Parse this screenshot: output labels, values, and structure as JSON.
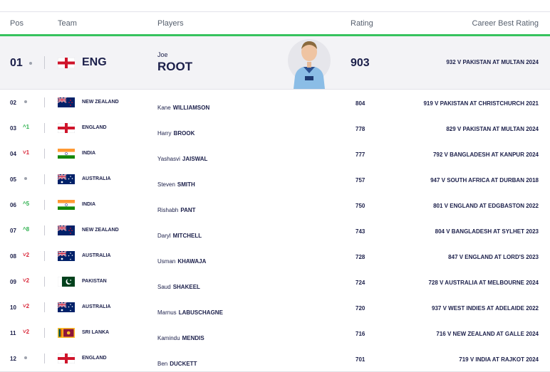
{
  "headers": {
    "pos": "Pos",
    "team": "Team",
    "players": "Players",
    "rating": "Rating",
    "best": "Career Best Rating"
  },
  "featured": {
    "pos": "01",
    "team": "ENG",
    "flag": "eng",
    "first": "Joe",
    "last": "ROOT",
    "rating": "903",
    "best": "932 V PAKISTAN AT MULTAN 2024"
  },
  "rows": [
    {
      "pos": "02",
      "move": "",
      "dir": "same",
      "team": "NEW ZEALAND",
      "flag": "nz",
      "first": "Kane",
      "last": "WILLIAMSON",
      "rating": "804",
      "best": "919 V PAKISTAN AT CHRISTCHURCH 2021"
    },
    {
      "pos": "03",
      "move": "1",
      "dir": "up",
      "team": "ENGLAND",
      "flag": "eng",
      "first": "Harry",
      "last": "BROOK",
      "rating": "778",
      "best": "829 V PAKISTAN AT MULTAN 2024"
    },
    {
      "pos": "04",
      "move": "1",
      "dir": "down",
      "team": "INDIA",
      "flag": "ind",
      "first": "Yashasvi",
      "last": "JAISWAL",
      "rating": "777",
      "best": "792 V BANGLADESH AT KANPUR 2024"
    },
    {
      "pos": "05",
      "move": "",
      "dir": "same",
      "team": "AUSTRALIA",
      "flag": "aus",
      "first": "Steven",
      "last": "SMITH",
      "rating": "757",
      "best": "947 V SOUTH AFRICA AT DURBAN 2018"
    },
    {
      "pos": "06",
      "move": "5",
      "dir": "up",
      "team": "INDIA",
      "flag": "ind",
      "first": "Rishabh",
      "last": "PANT",
      "rating": "750",
      "best": "801 V ENGLAND AT EDGBASTON 2022"
    },
    {
      "pos": "07",
      "move": "8",
      "dir": "up",
      "team": "NEW ZEALAND",
      "flag": "nz",
      "first": "Daryl",
      "last": "MITCHELL",
      "rating": "743",
      "best": "804 V BANGLADESH AT SYLHET 2023"
    },
    {
      "pos": "08",
      "move": "2",
      "dir": "down",
      "team": "AUSTRALIA",
      "flag": "aus",
      "first": "Usman",
      "last": "KHAWAJA",
      "rating": "728",
      "best": "847 V ENGLAND AT LORD'S 2023"
    },
    {
      "pos": "09",
      "move": "2",
      "dir": "down",
      "team": "PAKISTAN",
      "flag": "pak",
      "first": "Saud",
      "last": "SHAKEEL",
      "rating": "724",
      "best": "728 V AUSTRALIA AT MELBOURNE 2024"
    },
    {
      "pos": "10",
      "move": "2",
      "dir": "down",
      "team": "AUSTRALIA",
      "flag": "aus",
      "first": "Marnus",
      "last": "LABUSCHAGNE",
      "rating": "720",
      "best": "937 V WEST INDIES AT ADELAIDE 2022"
    },
    {
      "pos": "11",
      "move": "2",
      "dir": "down",
      "team": "SRI LANKA",
      "flag": "sl",
      "first": "Kamindu",
      "last": "MENDIS",
      "rating": "716",
      "best": "716 V NEW ZEALAND AT GALLE 2024"
    },
    {
      "pos": "12",
      "move": "",
      "dir": "same",
      "team": "ENGLAND",
      "flag": "eng",
      "first": "Ben",
      "last": "DUCKETT",
      "rating": "701",
      "best": "719 V INDIA AT RAJKOT 2024"
    }
  ],
  "colors": {
    "navy": "#1b1f4a",
    "green": "#36c25e",
    "up": "#2fb14f",
    "down": "#d9283a"
  }
}
